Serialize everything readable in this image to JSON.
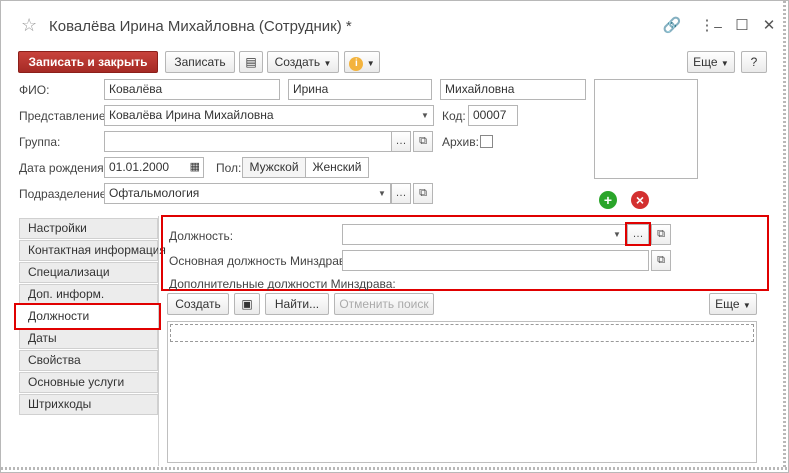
{
  "window": {
    "title": "Ковалёва Ирина Михайловна (Сотрудник) *"
  },
  "toolbar": {
    "save_close": "Записать и закрыть",
    "save": "Записать",
    "create": "Создать",
    "more": "Еще",
    "help": "?"
  },
  "form": {
    "fio_label": "ФИО:",
    "last_name": "Ковалёва",
    "first_name": "Ирина",
    "middle_name": "Михайловна",
    "representation_label": "Представление:",
    "representation": "Ковалёва Ирина Михайловна",
    "code_label": "Код:",
    "code": "00007",
    "group_label": "Группа:",
    "group": "",
    "archive_label": "Архив:",
    "birthdate_label": "Дата рождения:",
    "birthdate": "01.01.2000",
    "gender_label": "Пол:",
    "gender_male": "Мужской",
    "gender_female": "Женский",
    "department_label": "Подразделение:",
    "department": "Офтальмология"
  },
  "tabs": [
    {
      "label": "Настройки"
    },
    {
      "label": "Контактная информация"
    },
    {
      "label": "Специализаци"
    },
    {
      "label": "Доп. информ."
    },
    {
      "label": "Должности"
    },
    {
      "label": "Даты"
    },
    {
      "label": "Свойства"
    },
    {
      "label": "Основные услуги"
    },
    {
      "label": "Штрихкоды"
    }
  ],
  "positions": {
    "position_label": "Должность:",
    "position_value": "",
    "main_position_label": "Основная должность Минздрава:",
    "main_position_value": "",
    "additional_label": "Дополнительные должности Минздрава:",
    "create": "Создать",
    "find": "Найти...",
    "cancel_search": "Отменить поиск",
    "more": "Еще"
  },
  "colors": {
    "primary": "#b8312b",
    "highlight": "#e00000",
    "add": "#2aa52a",
    "remove": "#d33030"
  }
}
